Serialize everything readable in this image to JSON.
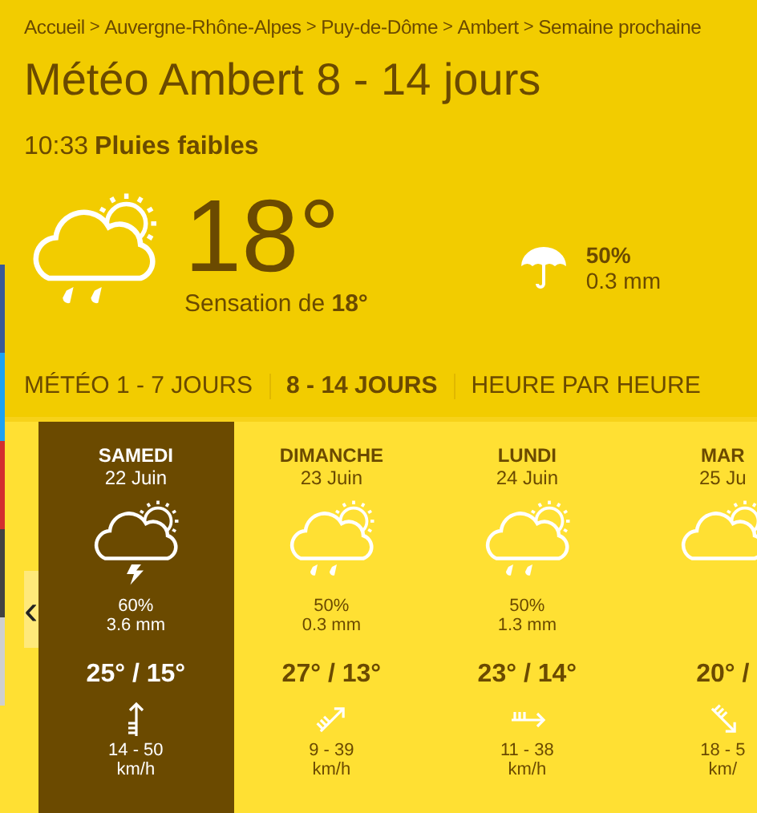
{
  "breadcrumb": [
    "Accueil",
    "Auvergne-Rhône-Alpes",
    "Puy-de-Dôme",
    "Ambert",
    "Semaine prochaine"
  ],
  "breadcrumb_separator": ">",
  "title": "Météo Ambert 8 - 14 jours",
  "current": {
    "time": "10:33",
    "condition": "Pluies faibles",
    "kind": "rain",
    "temperature": "18°",
    "feels_like": "Sensation de **18°**",
    "rain_chance": "50%",
    "rain_amount": "0.3 mm"
  },
  "share_strip": [
    {
      "color": "#3b5998"
    },
    {
      "color": "#1da1f2"
    },
    {
      "color": "#d32f2f"
    },
    {
      "color": "#424242"
    },
    {
      "color": "#cfcfcf"
    }
  ],
  "tabs": [
    {
      "label": "MÉTÉO 1 - 7 JOURS",
      "selected": false
    },
    {
      "label": "8 - 14 JOURS",
      "selected": true
    },
    {
      "label": "HEURE PAR HEURE",
      "selected": false
    }
  ],
  "prev_button": "‹",
  "days": [
    {
      "day": "SAMEDI",
      "date": "22 Juin",
      "kind": "storm",
      "rain_chance": "60%",
      "rain_amount": "3.6 mm",
      "temps": "25° / 15°",
      "wind": "14 - 50",
      "wind_unit": "km/h",
      "selected": true
    },
    {
      "day": "DIMANCHE",
      "date": "23 Juin",
      "kind": "rain",
      "rain_chance": "50%",
      "rain_amount": "0.3 mm",
      "temps": "27° / 13°",
      "wind": "9 - 39",
      "wind_unit": "km/h",
      "selected": false
    },
    {
      "day": "LUNDI",
      "date": "24 Juin",
      "kind": "rain",
      "rain_chance": "50%",
      "rain_amount": "1.3 mm",
      "temps": "23° / 14°",
      "wind": "11 - 38",
      "wind_unit": "km/h",
      "selected": false
    },
    {
      "day": "MAR",
      "date": "25 Ju",
      "kind": "cloudy",
      "temps": "20° /",
      "wind": "18 - 5",
      "wind_unit": "km/",
      "selected": false
    }
  ]
}
